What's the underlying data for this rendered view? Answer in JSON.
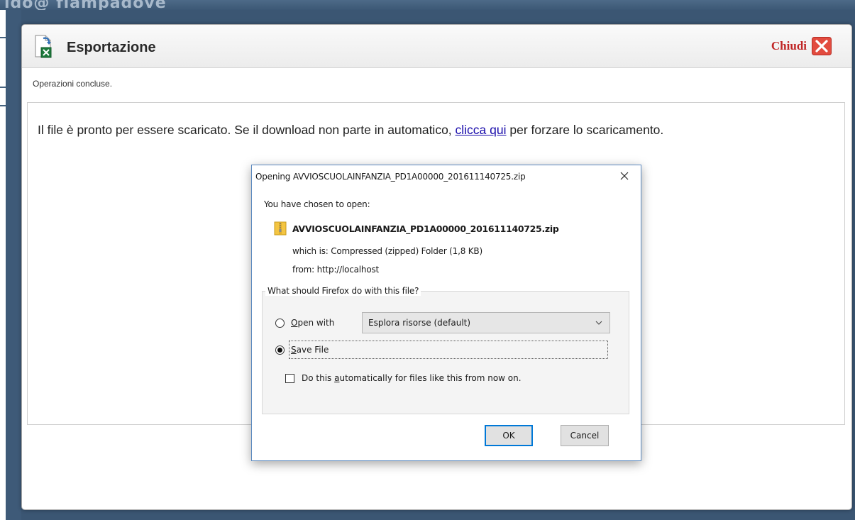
{
  "background": {
    "logo_text": "ido@ fiampadove"
  },
  "window": {
    "title": "Esportazione",
    "close_label": "Chiudi",
    "status": "Operazioni concluse.",
    "message_before": "Il file è pronto per essere scaricato. Se il download non parte in automatico, ",
    "message_link": "clicca qui",
    "message_after": " per forzare lo scaricamento.",
    "icons": {
      "title": "excel-export-icon",
      "close": "close-icon"
    }
  },
  "dialog": {
    "title": "Opening AVVIOSCUOLAINFANZIA_PD1A00000_201611140725.zip",
    "chosen_label": "You have chosen to open:",
    "file_name": "AVVIOSCUOLAINFANZIA_PD1A00000_201611140725.zip",
    "which_is_label": "which is:",
    "which_is_value": "Compressed (zipped) Folder (1,8 KB)",
    "from_label": "from:",
    "from_value": "http://localhost",
    "group_label": "What should Firefox do with this file?",
    "open_with": {
      "accesskey": "O",
      "rest": "pen with",
      "selected": false
    },
    "app_select": {
      "value": "Esplora risorse (default)"
    },
    "save_file": {
      "accesskey": "S",
      "rest": "ave File",
      "selected": true
    },
    "auto": {
      "before": "Do this ",
      "accesskey": "a",
      "after": "utomatically for files like this from now on.",
      "checked": false
    },
    "ok_label": "OK",
    "cancel_label": "Cancel",
    "icons": {
      "file": "zip-folder-icon",
      "close": "close-icon",
      "select": "chevron-down-icon"
    }
  },
  "colors": {
    "close_label": "#c02525",
    "link": "#1a0dab",
    "dialog_border": "#5b89bf",
    "default_button": "#0078d7"
  }
}
